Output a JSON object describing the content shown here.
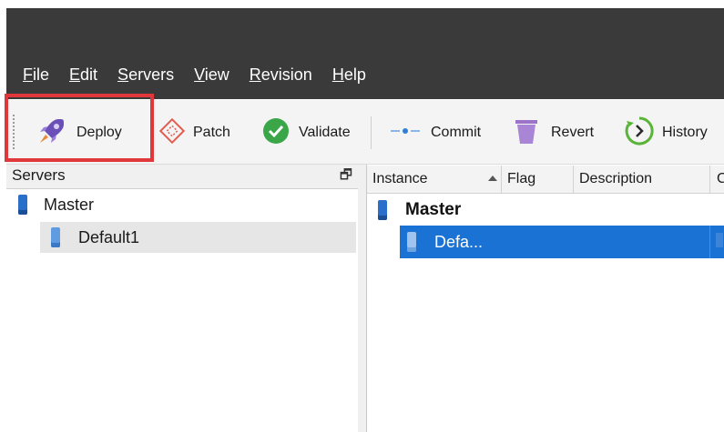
{
  "menu": [
    {
      "underline": "F",
      "rest": "ile"
    },
    {
      "underline": "E",
      "rest": "dit"
    },
    {
      "underline": "S",
      "rest": "ervers"
    },
    {
      "underline": "V",
      "rest": "iew"
    },
    {
      "underline": "R",
      "rest": "evision"
    },
    {
      "underline": "H",
      "rest": "elp"
    }
  ],
  "toolbar": {
    "deploy": "Deploy",
    "patch": "Patch",
    "validate": "Validate",
    "commit": "Commit",
    "revert": "Revert",
    "history": "History"
  },
  "servers_panel": {
    "title": "Servers",
    "restore_glyph": "🗗",
    "tree": [
      {
        "label": "Master"
      },
      {
        "label": "Default1"
      }
    ]
  },
  "grid": {
    "columns": [
      "Instance",
      "Flag",
      "Description",
      "C"
    ],
    "rows": [
      {
        "instance": "Master"
      },
      {
        "instance": "Defa..."
      }
    ]
  },
  "colors": {
    "highlight": "#e0383a",
    "selection": "#1a72d4",
    "server_icon": "#2a6fc9"
  },
  "icons": {
    "deploy": "rocket-icon",
    "patch": "patch-icon",
    "validate": "check-circle-icon",
    "commit": "commit-icon",
    "revert": "trash-icon",
    "history": "history-icon"
  }
}
